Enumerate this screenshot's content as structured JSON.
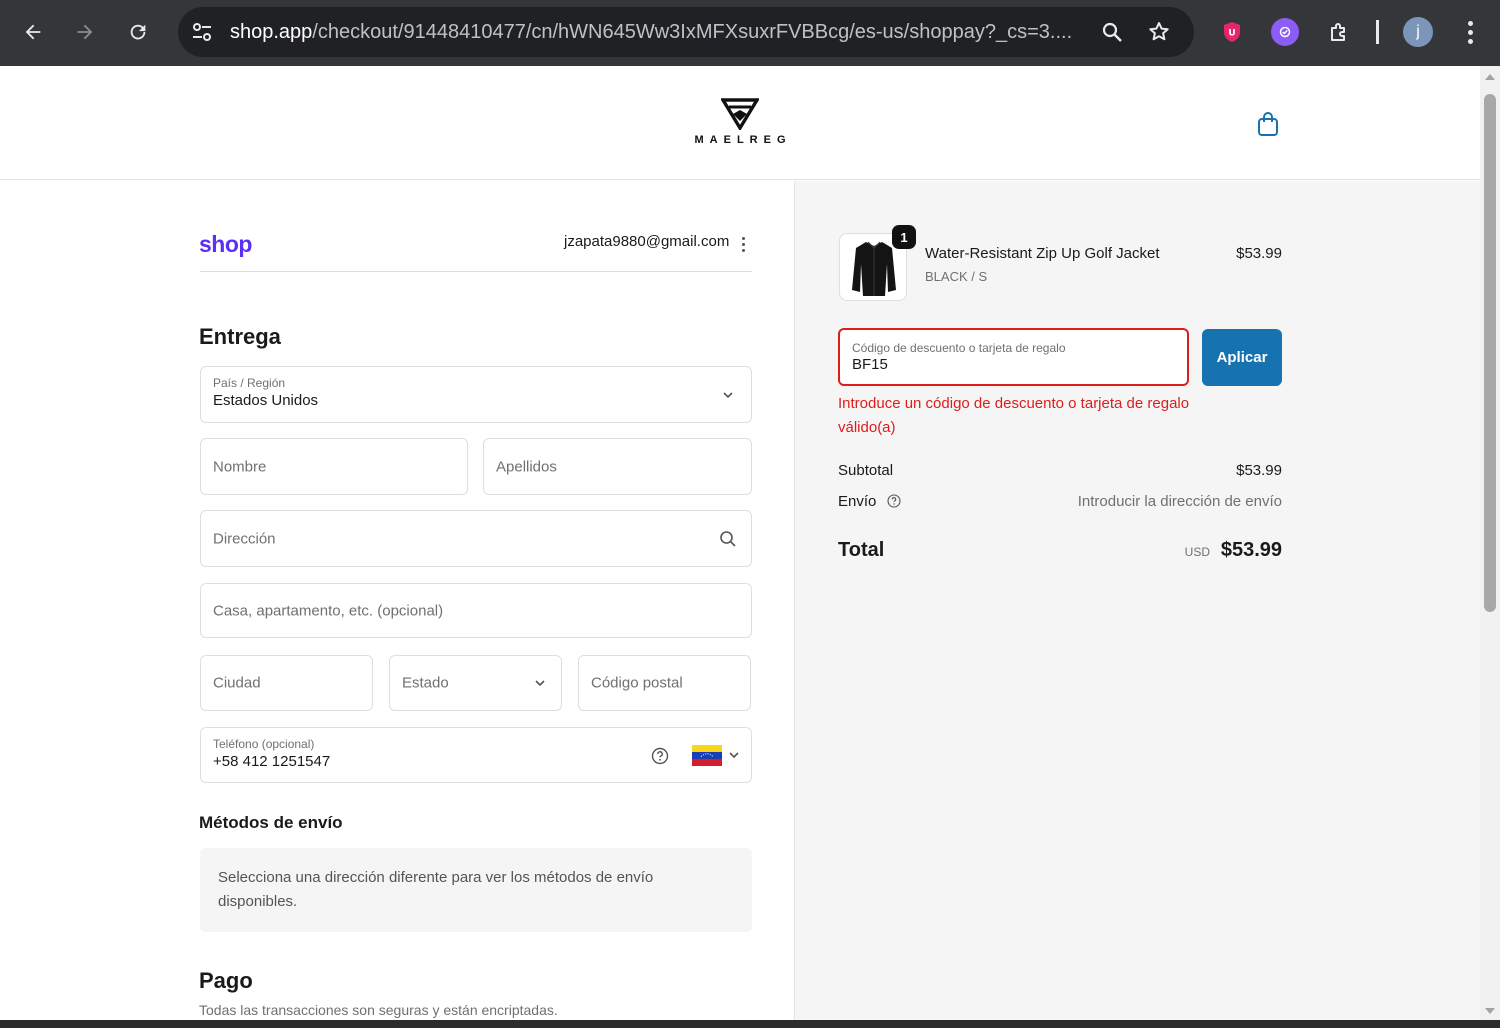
{
  "browser": {
    "url_host": "shop.app",
    "url_path": "/checkout/91448410477/cn/hWN645Ww3IxMFXsuxrFVBBcg/es-us/shoppay?_cs=3....",
    "avatar_letter": "j"
  },
  "store": {
    "brand_name": "MAELREG"
  },
  "account": {
    "shop_logo": "shop",
    "email": "jzapata9880@gmail.com"
  },
  "delivery": {
    "title": "Entrega",
    "country_label": "País / Región",
    "country_value": "Estados Unidos",
    "first_name_placeholder": "Nombre",
    "last_name_placeholder": "Apellidos",
    "address_placeholder": "Dirección",
    "apartment_placeholder": "Casa, apartamento, etc. (opcional)",
    "city_placeholder": "Ciudad",
    "state_placeholder": "Estado",
    "zip_placeholder": "Código postal",
    "phone_label": "Teléfono (opcional)",
    "phone_value": "+58 412 1251547"
  },
  "shipping_methods": {
    "title": "Métodos de envío",
    "info": "Selecciona una dirección diferente para ver los métodos de envío disponibles."
  },
  "payment": {
    "title": "Pago",
    "note": "Todas las transacciones son seguras y están encriptadas."
  },
  "order": {
    "item": {
      "quantity": "1",
      "name": "Water-Resistant Zip Up Golf Jacket",
      "variant": "BLACK / S",
      "price": "$53.99"
    },
    "discount_label": "Código de descuento o tarjeta de regalo",
    "discount_value": "BF15",
    "apply_label": "Aplicar",
    "error": "Introduce un código de descuento o tarjeta de regalo válido(a)",
    "subtotal_label": "Subtotal",
    "subtotal_value": "$53.99",
    "shipping_label": "Envío",
    "shipping_value": "Introducir la dirección de envío",
    "total_label": "Total",
    "currency": "USD",
    "total_value": "$53.99"
  },
  "colors": {
    "accent": "#1773b0",
    "shop_brand": "#5a31f4",
    "error": "#dd1d1d"
  }
}
